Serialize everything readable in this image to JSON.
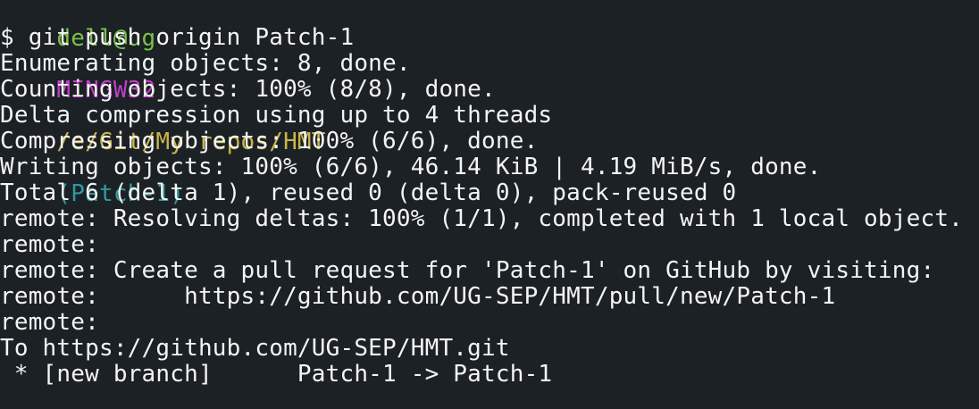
{
  "colors": {
    "background": "#1c2125",
    "text": "#f4f4f4",
    "user_host": "#7bc14a",
    "system": "#c23fc7",
    "path": "#c7b64a",
    "branch": "#2f9ba0"
  },
  "prompt": {
    "user_host": "dell@ug",
    "system": "MINGW32",
    "path": "/e/Git/My repos/HMT",
    "branch": "(Patch-1)"
  },
  "output_lines": [
    "$ git push origin Patch-1",
    "Enumerating objects: 8, done.",
    "Counting objects: 100% (8/8), done.",
    "Delta compression using up to 4 threads",
    "Compressing objects: 100% (6/6), done.",
    "Writing objects: 100% (6/6), 46.14 KiB | 4.19 MiB/s, done.",
    "Total 6 (delta 1), reused 0 (delta 0), pack-reused 0",
    "remote: Resolving deltas: 100% (1/1), completed with 1 local object.",
    "remote:",
    "remote: Create a pull request for 'Patch-1' on GitHub by visiting:",
    "remote:      https://github.com/UG-SEP/HMT/pull/new/Patch-1",
    "remote:",
    "To https://github.com/UG-SEP/HMT.git",
    " * [new branch]      Patch-1 -> Patch-1"
  ]
}
